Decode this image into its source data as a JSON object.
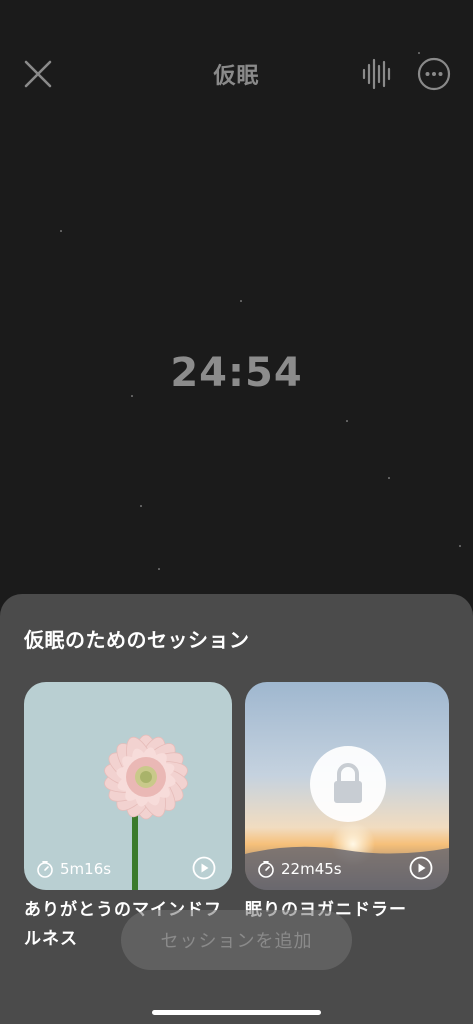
{
  "header": {
    "title": "仮眠",
    "close_icon": "close-icon",
    "sound_icon": "sound-wave-icon",
    "more_icon": "more-options-icon"
  },
  "timer": {
    "remaining": "24:54"
  },
  "sheet": {
    "title": "仮眠のためのセッション",
    "sessions": [
      {
        "label": "ありがとうのマインドフルネス",
        "duration": "5m16s",
        "locked": false
      },
      {
        "label": "眠りのヨガニドラー",
        "duration": "22m45s",
        "locked": true
      }
    ],
    "add_button_label": "セッションを追加"
  },
  "colors": {
    "background": "#1b1b1b",
    "sheet": "#4b4b4b",
    "muted_text": "#8a8a8a"
  }
}
